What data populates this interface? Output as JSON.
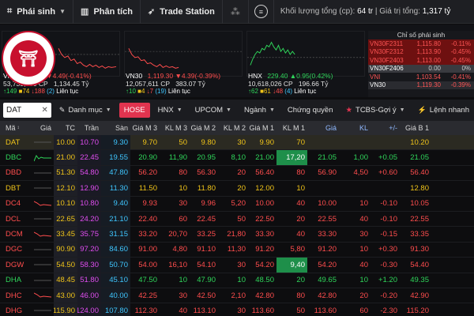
{
  "topbar": {
    "items": [
      {
        "label": "Phái sinh",
        "icon": "chart-icon",
        "caret": true
      },
      {
        "label": "Phân tích",
        "icon": "bar-chart-icon",
        "caret": false
      },
      {
        "label": "Trade Station",
        "icon": "rocket-icon",
        "caret": false
      }
    ],
    "volume_label": "Khối lượng tổng (cp):",
    "volume_value": "64 tr",
    "value_label": "Giá trị tổng:",
    "value_value": "1,317 tỷ"
  },
  "indices": [
    {
      "name": "VN",
      "val": "",
      "chg": "4.49(-0.41%)",
      "vol": "53,739,900 CP",
      "valv": "1,134.45 Tỷ",
      "up": "149",
      "ref": "74",
      "down": "188",
      "down2": "2",
      "status": "Liên tục",
      "color": "#ff4d4d"
    },
    {
      "name": "VN30",
      "val": "1,119.30",
      "chg": "4.39(-0.39%)",
      "vol": "12,057,611 CP",
      "valv": "383.07 Tỷ",
      "up": "10",
      "ref": "4",
      "down": "7",
      "down2": "19",
      "status": "Liên tục",
      "color": "#ff4d4d"
    },
    {
      "name": "HNX",
      "val": "229.40",
      "chg": "0.95(0.42%)",
      "vol": "10,618,026 CP",
      "valv": "196.66 Tỷ",
      "up": "62",
      "ref": "61",
      "down": "48",
      "down2": "4",
      "status": "Liên tục",
      "color": "#2fd55a"
    }
  ],
  "derivatives": {
    "title": "Chỉ số phái sinh",
    "rows": [
      {
        "name": "VN30F2311",
        "price": "1,115.80",
        "chg": "-0.11%"
      },
      {
        "name": "VN30F2312",
        "price": "1,113.90",
        "chg": "-0.45%"
      },
      {
        "name": "VN30F2403",
        "price": "1,113.00",
        "chg": "-0.45%"
      },
      {
        "name": "VN30F2406",
        "price": "0.00",
        "chg": "0%"
      },
      {
        "name": "VNI",
        "price": "1,103.54",
        "chg": "-0.41%"
      },
      {
        "name": "VN30",
        "price": "1,119.30",
        "chg": "-0.39%"
      }
    ]
  },
  "filter": {
    "search_value": "DAT",
    "items": [
      "Danh mục",
      "HOSE",
      "HNX",
      "UPCOM",
      "Ngành",
      "Chứng quyền",
      "TCBS-Gợi ý",
      "Lệnh nhanh"
    ]
  },
  "table": {
    "headers": [
      "Mã",
      "Giá",
      "TC",
      "Trần",
      "Sàn",
      "Giá M 3",
      "KL M 3",
      "Giá M 2",
      "KL M 2",
      "Giá M 1",
      "KL M 1",
      "Giá",
      "KL",
      "+/-",
      "Giá B 1"
    ],
    "rows": [
      {
        "code": "DAT",
        "tc": "10.00",
        "ceil": "10.70",
        "floor": "9.30",
        "b3": "9.70",
        "kb3": "50",
        "b2": "9.80",
        "kb2": "30",
        "b1": "9.90",
        "kb1": "70",
        "p": "",
        "kl": "",
        "chg": "",
        "s1": "10.20",
        "color": "#f0c419",
        "spark": "flat"
      },
      {
        "code": "DBC",
        "tc": "21.00",
        "ceil": "22.45",
        "floor": "19.55",
        "b3": "20.90",
        "kb3": "11,90",
        "b2": "20.95",
        "kb2": "8,10",
        "b1": "21.00",
        "kb1": "17,20",
        "p": "21.05",
        "kl": "1,00",
        "chg": "+0.05",
        "s1": "21.05",
        "color": "#2fd55a",
        "spark": "up"
      },
      {
        "code": "DBD",
        "tc": "51.30",
        "ceil": "54.80",
        "floor": "47.80",
        "b3": "56.20",
        "kb3": "80",
        "b2": "56.30",
        "kb2": "20",
        "b1": "56.40",
        "kb1": "80",
        "p": "56.90",
        "kl": "4,50",
        "chg": "+0.60",
        "s1": "56.40",
        "color": "#ff4d4d",
        "spark": "flat"
      },
      {
        "code": "DBT",
        "tc": "12.10",
        "ceil": "12.90",
        "floor": "11.30",
        "b3": "11.50",
        "kb3": "10",
        "b2": "11.80",
        "kb2": "20",
        "b1": "12.00",
        "kb1": "10",
        "p": "",
        "kl": "",
        "chg": "",
        "s1": "12.80",
        "color": "#f0c419",
        "spark": "flat"
      },
      {
        "code": "DC4",
        "tc": "10.10",
        "ceil": "10.80",
        "floor": "9.40",
        "b3": "9.93",
        "kb3": "30",
        "b2": "9.96",
        "kb2": "5,20",
        "b1": "10.00",
        "kb1": "40",
        "p": "10.00",
        "kl": "10",
        "chg": "-0.10",
        "s1": "10.05",
        "color": "#ff4d4d",
        "spark": "down"
      },
      {
        "code": "DCL",
        "tc": "22.65",
        "ceil": "24.20",
        "floor": "21.10",
        "b3": "22.40",
        "kb3": "60",
        "b2": "22.45",
        "kb2": "50",
        "b1": "22.50",
        "kb1": "20",
        "p": "22.55",
        "kl": "40",
        "chg": "-0.10",
        "s1": "22.55",
        "color": "#ff4d4d",
        "spark": "flat"
      },
      {
        "code": "DCM",
        "tc": "33.45",
        "ceil": "35.75",
        "floor": "31.15",
        "b3": "33.20",
        "kb3": "20,70",
        "b2": "33.25",
        "kb2": "21,80",
        "b1": "33.30",
        "kb1": "40",
        "p": "33.30",
        "kl": "30",
        "chg": "-0.15",
        "s1": "33.35",
        "color": "#ff4d4d",
        "spark": "down"
      },
      {
        "code": "DGC",
        "tc": "90.90",
        "ceil": "97.20",
        "floor": "84.60",
        "b3": "91.00",
        "kb3": "4,80",
        "b2": "91.10",
        "kb2": "11,30",
        "b1": "91.20",
        "kb1": "5,80",
        "p": "91.20",
        "kl": "10",
        "chg": "+0.30",
        "s1": "91.30",
        "color": "#ff4d4d",
        "spark": "flat"
      },
      {
        "code": "DGW",
        "tc": "54.50",
        "ceil": "58.30",
        "floor": "50.70",
        "b3": "54.00",
        "kb3": "16,10",
        "b2": "54.10",
        "kb2": "30",
        "b1": "54.20",
        "kb1": "9,40",
        "p": "54.20",
        "kl": "40",
        "chg": "-0.30",
        "s1": "54.40",
        "color": "#ff4d4d",
        "spark": "flat"
      },
      {
        "code": "DHA",
        "tc": "48.45",
        "ceil": "51.80",
        "floor": "45.10",
        "b3": "47.50",
        "kb3": "10",
        "b2": "47.90",
        "kb2": "10",
        "b1": "48.50",
        "kb1": "20",
        "p": "49.65",
        "kl": "10",
        "chg": "+1.20",
        "s1": "49.35",
        "color": "#2fd55a",
        "spark": "flat"
      },
      {
        "code": "DHC",
        "tc": "43.00",
        "ceil": "46.00",
        "floor": "40.00",
        "b3": "42.25",
        "kb3": "30",
        "b2": "42.50",
        "kb2": "2,10",
        "b1": "42.80",
        "kb1": "80",
        "p": "42.80",
        "kl": "20",
        "chg": "-0.20",
        "s1": "42.90",
        "color": "#ff4d4d",
        "spark": "down"
      },
      {
        "code": "DHG",
        "tc": "115.90",
        "ceil": "124.00",
        "floor": "107.80",
        "b3": "112.30",
        "kb3": "40",
        "b2": "113.10",
        "kb2": "30",
        "b1": "113.60",
        "kb1": "50",
        "p": "113.60",
        "kl": "60",
        "chg": "-2.30",
        "s1": "115.20",
        "color": "#ff4d4d",
        "spark": "flat"
      }
    ]
  },
  "colors": {
    "up": "#2fd55a",
    "down": "#ff4d4d",
    "ref": "#f0c419",
    "ceil": "#e04df0",
    "floor": "#3fc6ff",
    "accent": "#e0344f"
  }
}
